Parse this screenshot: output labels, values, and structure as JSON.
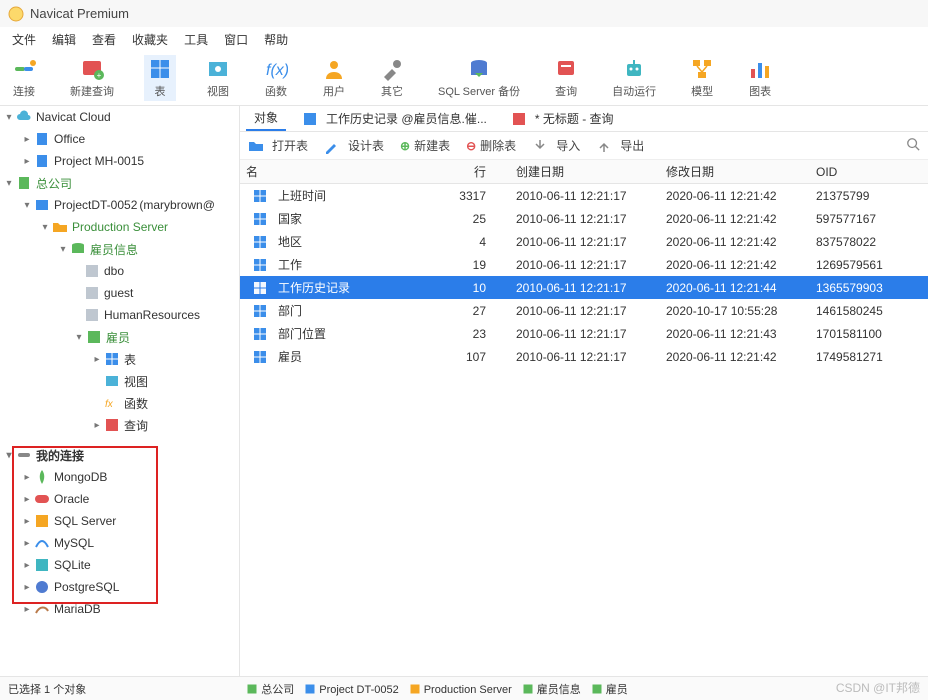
{
  "window": {
    "title": "Navicat Premium"
  },
  "menu": {
    "items": [
      "文件",
      "编辑",
      "查看",
      "收藏夹",
      "工具",
      "窗口",
      "帮助"
    ]
  },
  "toolbar": {
    "items": [
      {
        "name": "connect",
        "label": "连接"
      },
      {
        "name": "new-query",
        "label": "新建查询"
      },
      {
        "name": "tables",
        "label": "表",
        "active": true
      },
      {
        "name": "views",
        "label": "视图"
      },
      {
        "name": "functions",
        "label": "函数"
      },
      {
        "name": "users",
        "label": "用户"
      },
      {
        "name": "others",
        "label": "其它"
      },
      {
        "name": "sqlserver-bk",
        "label": "SQL Server 备份"
      },
      {
        "name": "query",
        "label": "查询"
      },
      {
        "name": "auto-run",
        "label": "自动运行"
      },
      {
        "name": "model",
        "label": "模型"
      },
      {
        "name": "chart",
        "label": "图表"
      }
    ]
  },
  "tree": {
    "navicat_cloud": "Navicat Cloud",
    "cloud_office": "Office",
    "cloud_project": "Project MH-0015",
    "root_company": "总公司",
    "project_dt": "ProjectDT-0052",
    "project_dt_suffix": "(marybrown@",
    "production_server": "Production Server",
    "employee_info": "雇员信息",
    "dbo": "dbo",
    "guest": "guest",
    "human_resources": "HumanResources",
    "employees": "雇员",
    "subtables": "表",
    "subviews": "视图",
    "subfunctions": "函数",
    "subquery": "查询",
    "my_connections": "我的连接",
    "my": {
      "mongodb": "MongoDB",
      "oracle": "Oracle",
      "sqlserver": "SQL Server",
      "mysql": "MySQL",
      "sqlite": "SQLite",
      "postgresql": "PostgreSQL",
      "mariadb": "MariaDB"
    }
  },
  "tabs": {
    "objects": "对象",
    "history": "工作历史记录 @雇员信息.催...",
    "untitled": "* 无标题 - 查询"
  },
  "actions": {
    "open": "打开表",
    "design": "设计表",
    "new": "新建表",
    "delete": "删除表",
    "import": "导入",
    "export": "导出"
  },
  "columns": {
    "name": "名",
    "rows": "行",
    "created": "创建日期",
    "modified": "修改日期",
    "oid": "OID"
  },
  "table_rows": [
    {
      "name": "上班时间",
      "rows": 3317,
      "created": "2010-06-11 12:21:17",
      "modified": "2020-06-11 12:21:42",
      "oid": "21375799"
    },
    {
      "name": "国家",
      "rows": 25,
      "created": "2010-06-11 12:21:17",
      "modified": "2020-06-11 12:21:42",
      "oid": "597577167"
    },
    {
      "name": "地区",
      "rows": 4,
      "created": "2010-06-11 12:21:17",
      "modified": "2020-06-11 12:21:42",
      "oid": "837578022"
    },
    {
      "name": "工作",
      "rows": 19,
      "created": "2010-06-11 12:21:17",
      "modified": "2020-06-11 12:21:42",
      "oid": "1269579561"
    },
    {
      "name": "工作历史记录",
      "rows": 10,
      "created": "2010-06-11 12:21:17",
      "modified": "2020-06-11 12:21:44",
      "oid": "1365579903",
      "selected": true
    },
    {
      "name": "部门",
      "rows": 27,
      "created": "2010-06-11 12:21:17",
      "modified": "2020-10-17 10:55:28",
      "oid": "1461580245"
    },
    {
      "name": "部门位置",
      "rows": 23,
      "created": "2010-06-11 12:21:17",
      "modified": "2020-06-11 12:21:43",
      "oid": "1701581100"
    },
    {
      "name": "雇员",
      "rows": 107,
      "created": "2010-06-11 12:21:17",
      "modified": "2020-06-11 12:21:42",
      "oid": "1749581271"
    }
  ],
  "status": {
    "selection": "已选择 1 个对象",
    "crumbs": [
      {
        "name": "company",
        "label": "总公司"
      },
      {
        "name": "project",
        "label": "Project DT-0052"
      },
      {
        "name": "server",
        "label": "Production Server"
      },
      {
        "name": "db",
        "label": "雇员信息"
      },
      {
        "name": "schema",
        "label": "雇员"
      }
    ]
  },
  "watermark": "CSDN @IT邦德",
  "colors": {
    "icon_blue": "#3b8eea",
    "icon_orange": "#f5a623",
    "icon_green": "#5bb85b",
    "icon_red": "#e25353",
    "icon_teal": "#3fb6c1",
    "icon_purple": "#4f7bd1",
    "accent_sel": "#2b7de9"
  }
}
